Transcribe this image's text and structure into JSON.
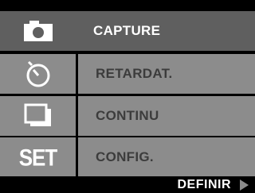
{
  "menu": {
    "items": [
      {
        "label": "CAPTURE",
        "icon": "camera-icon",
        "selected": true
      },
      {
        "label": "RETARDAT.",
        "icon": "self-timer-icon",
        "selected": false
      },
      {
        "label": "CONTINU",
        "icon": "continuous-shot-icon",
        "selected": false
      },
      {
        "label": "CONFIG.",
        "icon": "set-icon",
        "icon_text": "SET",
        "selected": false
      }
    ]
  },
  "footer": {
    "label": "DEFINIR",
    "icon": "right-arrow-icon"
  },
  "colors": {
    "row_bg": "#8c8c8c",
    "selected_bg": "#5f5f5f",
    "label": "#3c3c3c",
    "selected_label": "#ffffff"
  }
}
